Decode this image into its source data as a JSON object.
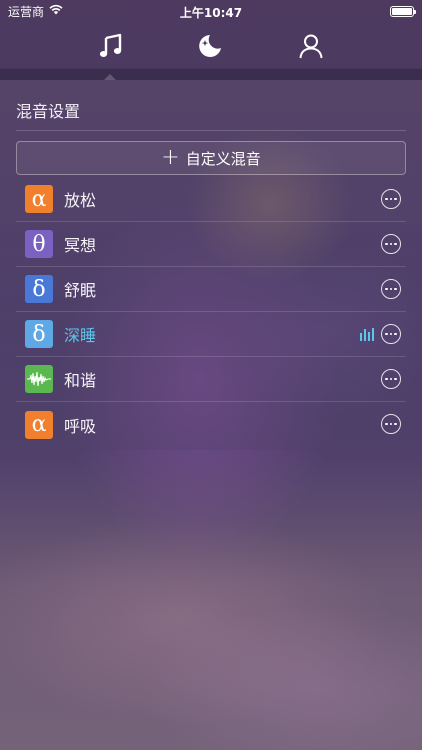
{
  "status_bar": {
    "carrier": "运营商",
    "time": "上午10:47"
  },
  "nav": {
    "tabs": [
      "music",
      "sleep",
      "profile"
    ],
    "active": "music"
  },
  "section": {
    "title": "混音设置"
  },
  "custom_mix": {
    "label": "自定义混音"
  },
  "mixes": [
    {
      "label": "放松",
      "symbol": "α",
      "color": "#f07f2e",
      "active": false
    },
    {
      "label": "冥想",
      "symbol": "θ",
      "color": "#7b62c2",
      "active": false
    },
    {
      "label": "舒眠",
      "symbol": "δ",
      "color": "#4a78d6",
      "active": false
    },
    {
      "label": "深睡",
      "symbol": "δ",
      "color": "#5ea8e6",
      "active": true
    },
    {
      "label": "和谐",
      "symbol": "wave",
      "color": "#5bb851",
      "active": false
    },
    {
      "label": "呼吸",
      "symbol": "α",
      "color": "#f07f2e",
      "active": false
    }
  ],
  "colors": {
    "active_text": "#5cc5ea"
  }
}
